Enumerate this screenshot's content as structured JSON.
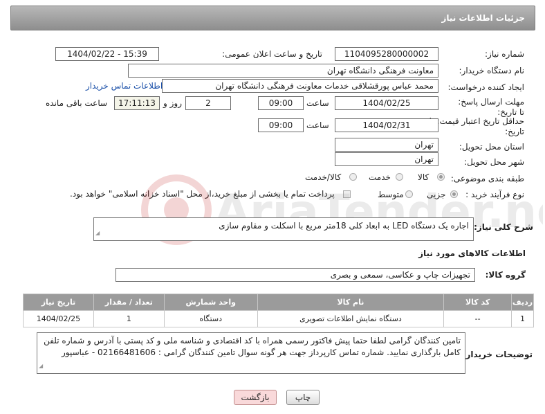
{
  "header": {
    "title": "جزئیات اطلاعات نیاز"
  },
  "fields": {
    "need_number_label": "شماره نیاز:",
    "need_number": "1104095280000002",
    "announce_label": "تاریخ و ساعت اعلان عمومی:",
    "announce_value": "1404/02/22 - 15:39",
    "buyer_org_label": "نام دستگاه خریدار:",
    "buyer_org": "معاونت فرهنگی دانشگاه تهران",
    "creator_label": "ایجاد کننده درخواست:",
    "creator": "محمد عباس پورقشلاقی خدمات معاونت فرهنگی دانشگاه تهران",
    "buyer_contact_link": "اطلاعات تماس خریدار",
    "deadline_label": "مهلت ارسال پاسخ: تا تاریخ:",
    "deadline_date": "1404/02/25",
    "hour_label": "ساعت",
    "deadline_time": "09:00",
    "days_value": "2",
    "days_label": "روز و",
    "remaining_time": "17:11:13",
    "remaining_label": "ساعت باقی مانده",
    "price_validity_label": "حداقل تاریخ اعتبار قیمت: تا تاریخ:",
    "price_date": "1404/02/31",
    "price_time": "09:00",
    "province_label": "استان محل تحویل:",
    "province": "تهران",
    "city_label": "شهر محل تحویل:",
    "city": "تهران",
    "category_label": "طبقه بندی موضوعی:",
    "category_options": [
      "کالا",
      "خدمت",
      "کالا/خدمت"
    ],
    "purchase_label": "نوع فرآیند خرید :",
    "purchase_options": [
      "جزیی",
      "متوسط"
    ],
    "purchase_note": "پرداخت تمام یا بخشی از مبلغ خرید،از محل \"اسناد خزانه اسلامی\" خواهد بود.",
    "summary_label": "شرح کلی نیاز:",
    "summary": "اجاره یک دستگاه LED به ابعاد کلی 18متر مربع با اسکلت و مقاوم سازی",
    "goods_info_title": "اطلاعات کالاهای مورد نیاز",
    "goods_group_label": "گروه کالا:",
    "goods_group": "تجهیزات چاپ و عکاسی، سمعی و بصری"
  },
  "table": {
    "headers": [
      "ردیف",
      "کد کالا",
      "نام کالا",
      "واحد شمارش",
      "تعداد / مقدار",
      "تاریخ نیاز"
    ],
    "rows": [
      [
        "1",
        "--",
        "دستگاه نمایش اطلاعات تصویری",
        "دستگاه",
        "1",
        "1404/02/25"
      ]
    ]
  },
  "buyer_notes_label": "توضیحات خریدار:",
  "buyer_notes": "تامین کنندگان گرامی لطفا حتما پیش فاکتور رسمی همراه با کد اقتصادی و شناسه ملی و کد پستی با آدرس و شماره تلفن کامل بارگذاری نمایید. شماره تماس کارپرداز جهت هر گونه سوال تامین کنندگان گرامی : 02166481606 - عباسپور",
  "buttons": {
    "print": "چاپ",
    "back": "بازگشت"
  },
  "watermark": "AriaTender.net",
  "colors": {
    "header": "#9e9e9e",
    "link": "#1a4fa8",
    "back_button": "#f9d9da"
  }
}
